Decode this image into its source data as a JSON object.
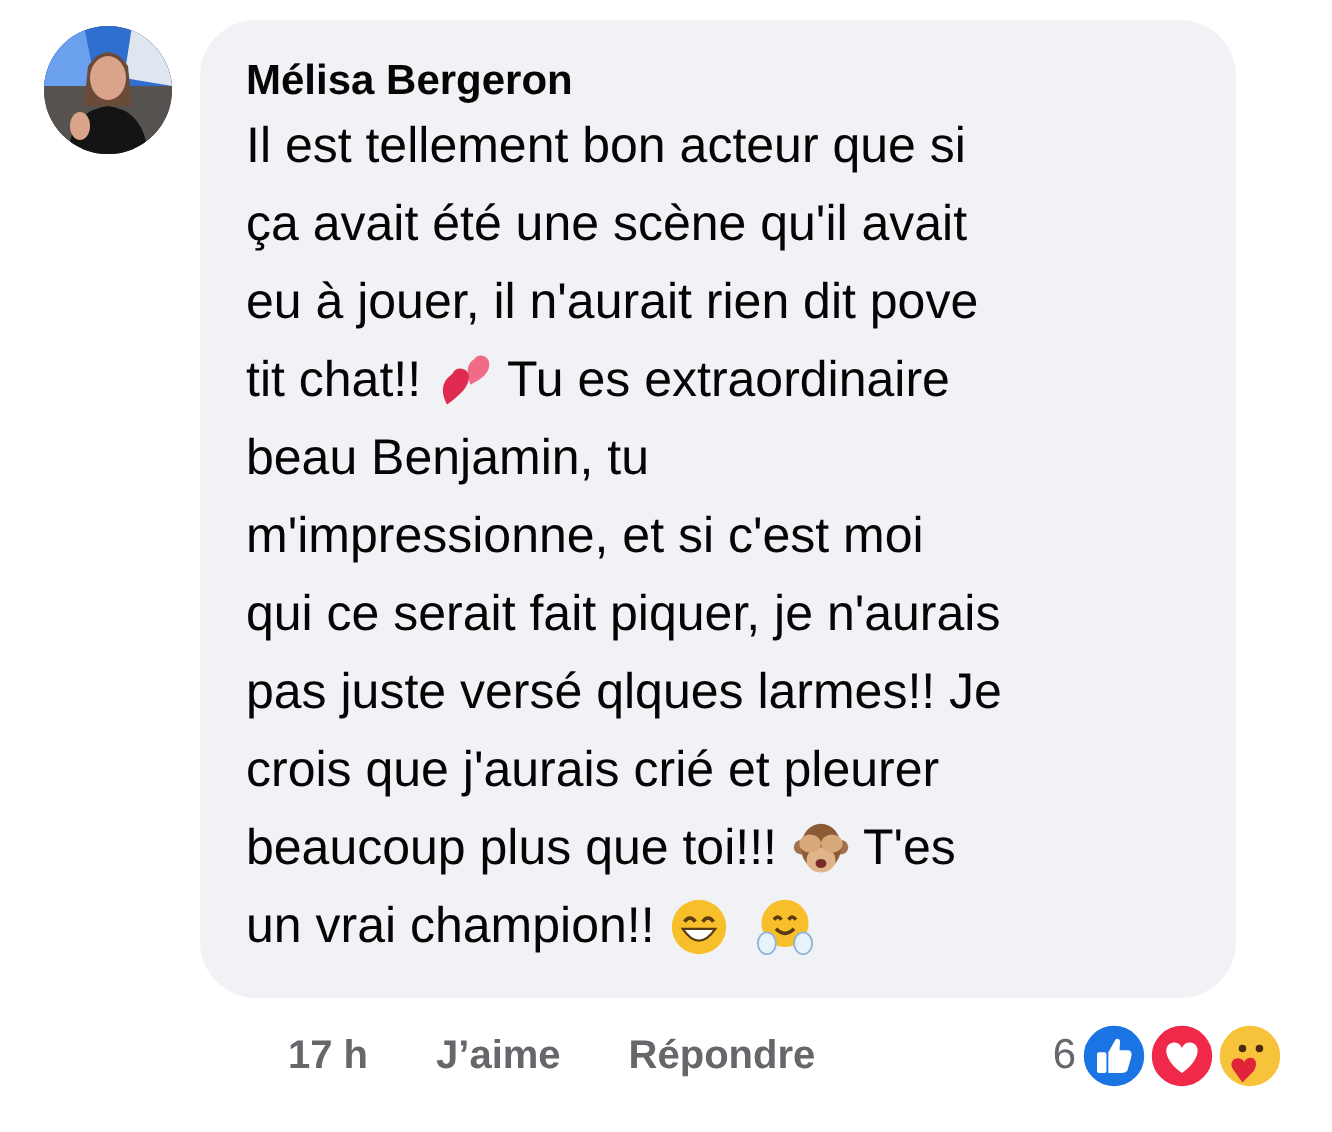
{
  "comment": {
    "author": "Mélisa Bergeron",
    "lines": [
      [
        {
          "kind": "text",
          "text": "Il est tellement bon acteur que si"
        }
      ],
      [
        {
          "kind": "text",
          "text": "ça avait été une scène qu'il avait"
        }
      ],
      [
        {
          "kind": "text",
          "text": "eu à jouer, il n'aurait rien dit pove"
        }
      ],
      [
        {
          "kind": "text",
          "text": "tit chat!!"
        },
        {
          "kind": "hearts"
        },
        {
          "kind": "text",
          "text": "Tu es extraordinaire"
        }
      ],
      [
        {
          "kind": "text",
          "text": "beau Benjamin, tu"
        }
      ],
      [
        {
          "kind": "text",
          "text": "m'impressionne, et si c'est moi"
        }
      ],
      [
        {
          "kind": "text",
          "text": "qui ce serait fait piquer, je n'aurais"
        }
      ],
      [
        {
          "kind": "text",
          "text": "pas juste versé qlques larmes!! Je"
        }
      ],
      [
        {
          "kind": "text",
          "text": "crois que j'aurais crié et pleurer"
        }
      ],
      [
        {
          "kind": "text",
          "text": "beaucoup plus que toi!!!"
        },
        {
          "kind": "monkey"
        },
        {
          "kind": "text",
          "text": "T'es"
        }
      ],
      [
        {
          "kind": "text",
          "text": "un vrai champion!!"
        },
        {
          "kind": "grin"
        },
        {
          "kind": "hug"
        }
      ]
    ],
    "time": "17 h",
    "like": "J’aime",
    "reply": "Répondre",
    "reaction_count": "6",
    "reactions": [
      {
        "kind": "like"
      },
      {
        "kind": "love"
      },
      {
        "kind": "care"
      }
    ]
  }
}
